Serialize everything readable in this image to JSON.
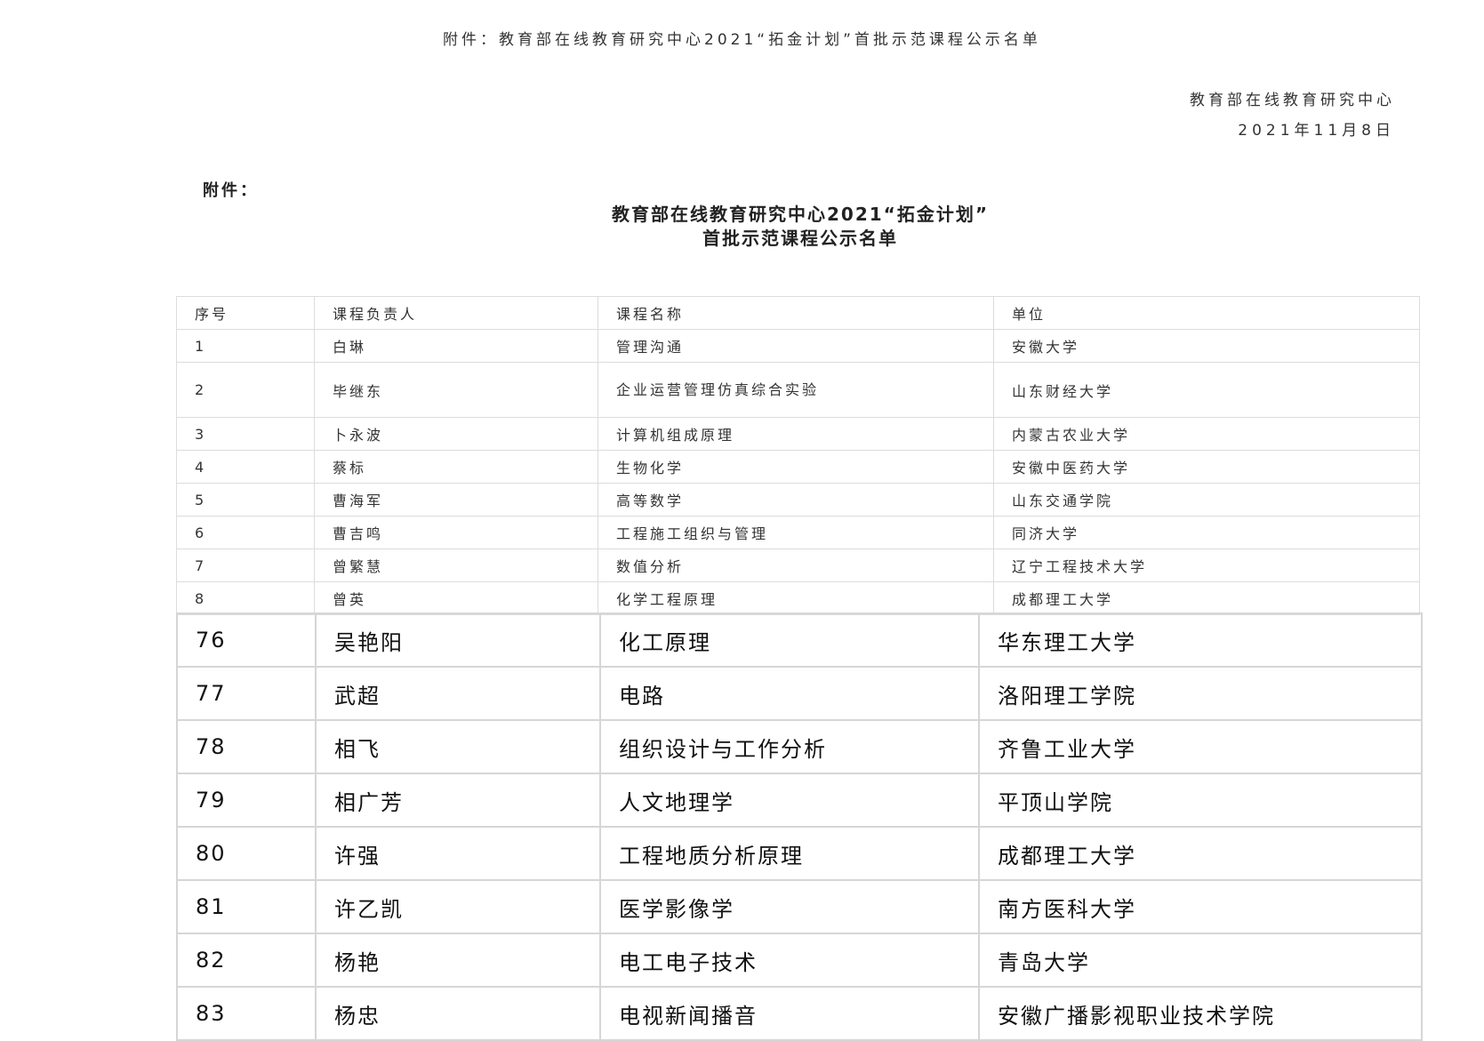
{
  "header": {
    "top_line": "附件：教育部在线教育研究中心2021“拓金计划”首批示范课程公示名单",
    "org": "教育部在线教育研究中心",
    "date": "2021年11月8日"
  },
  "document": {
    "attachment_label": "附件：",
    "title_line1": "教育部在线教育研究中心2021“拓金计划”",
    "title_line2": "首批示范课程公示名单"
  },
  "table_small": {
    "headers": [
      "序号",
      "课程负责人",
      "课程名称",
      "单位"
    ],
    "rows": [
      {
        "no": "1",
        "lead": "白琳",
        "course": "管理沟通",
        "unit": "安徽大学"
      },
      {
        "no": "2",
        "lead": "毕继东",
        "course": "企业运营管理仿真综合实验",
        "unit": "山东财经大学"
      },
      {
        "no": "3",
        "lead": "卜永波",
        "course": "计算机组成原理",
        "unit": "内蒙古农业大学"
      },
      {
        "no": "4",
        "lead": "蔡标",
        "course": "生物化学",
        "unit": "安徽中医药大学"
      },
      {
        "no": "5",
        "lead": "曹海军",
        "course": "高等数学",
        "unit": "山东交通学院"
      },
      {
        "no": "6",
        "lead": "曹吉鸣",
        "course": "工程施工组织与管理",
        "unit": "同济大学"
      },
      {
        "no": "7",
        "lead": "曾繁慧",
        "course": "数值分析",
        "unit": "辽宁工程技术大学"
      },
      {
        "no": "8",
        "lead": "曾英",
        "course": "化学工程原理",
        "unit": "成都理工大学"
      }
    ]
  },
  "table_big": {
    "rows": [
      {
        "no": "76",
        "lead": "吴艳阳",
        "course": "化工原理",
        "unit": "华东理工大学"
      },
      {
        "no": "77",
        "lead": "武超",
        "course": "电路",
        "unit": "洛阳理工学院"
      },
      {
        "no": "78",
        "lead": "相飞",
        "course": "组织设计与工作分析",
        "unit": "齐鲁工业大学"
      },
      {
        "no": "79",
        "lead": "相广芳",
        "course": "人文地理学",
        "unit": "平顶山学院"
      },
      {
        "no": "80",
        "lead": "许强",
        "course": "工程地质分析原理",
        "unit": "成都理工大学"
      },
      {
        "no": "81",
        "lead": "许乙凯",
        "course": "医学影像学",
        "unit": "南方医科大学"
      },
      {
        "no": "82",
        "lead": "杨艳",
        "course": "电工电子技术",
        "unit": "青岛大学"
      },
      {
        "no": "83",
        "lead": "杨忠",
        "course": "电视新闻播音",
        "unit": "安徽广播影视职业技术学院"
      }
    ]
  }
}
